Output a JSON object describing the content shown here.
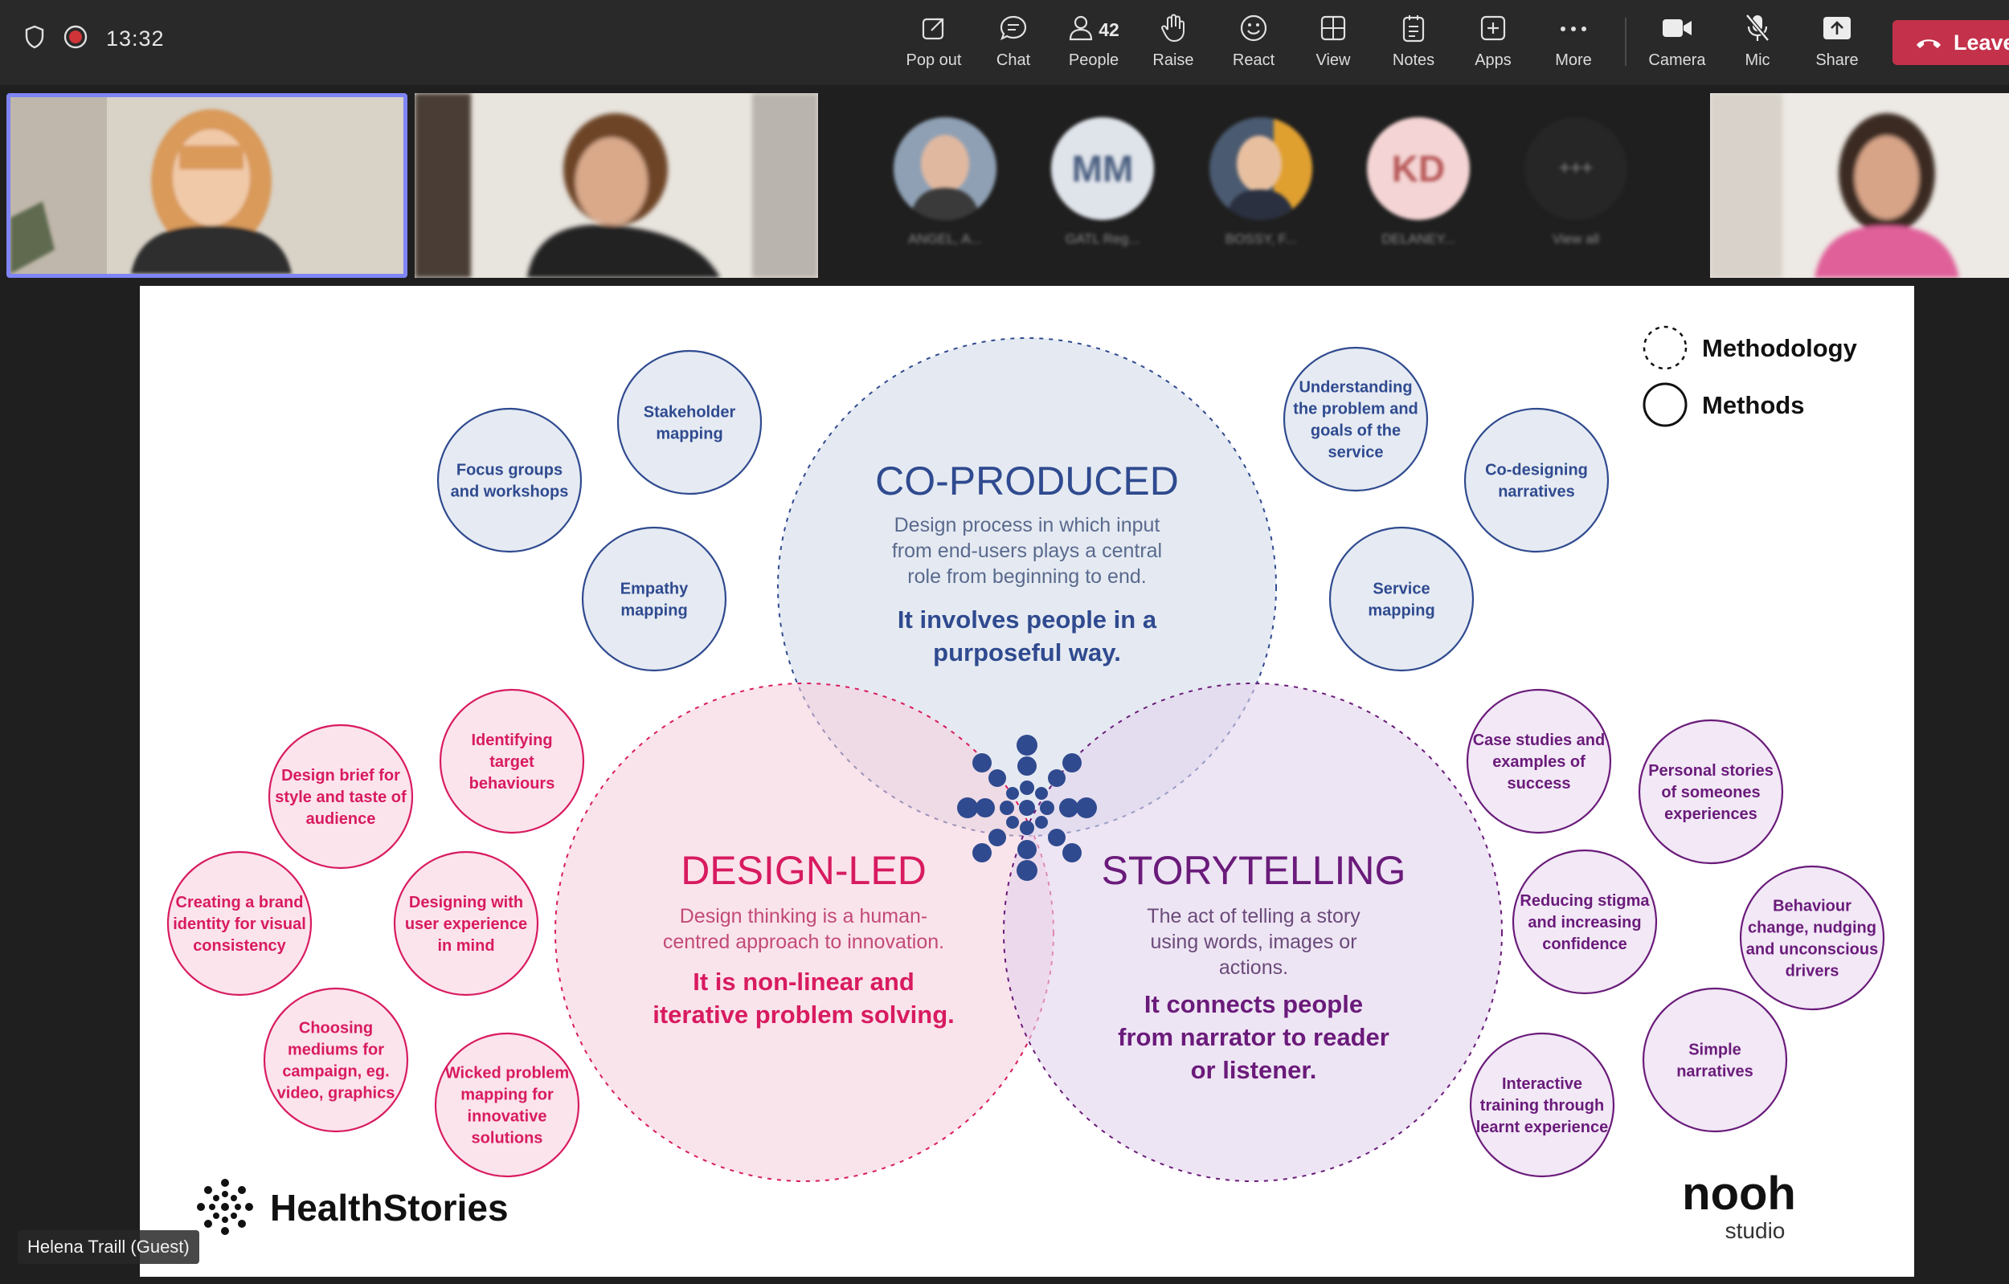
{
  "meeting": {
    "timer": "13:32"
  },
  "toolbar": {
    "popout": "Pop out",
    "chat": "Chat",
    "people": "People",
    "people_count": "42",
    "raise": "Raise",
    "react": "React",
    "view": "View",
    "notes": "Notes",
    "apps": "Apps",
    "more": "More",
    "camera": "Camera",
    "mic": "Mic",
    "share": "Share",
    "leave": "Leave"
  },
  "gallery": {
    "avatars": [
      {
        "initials": "",
        "name": "ANGEL, A..."
      },
      {
        "initials": "MM",
        "name": "GATL Reg..."
      },
      {
        "initials": "",
        "name": "BOSSY, F..."
      },
      {
        "initials": "KD",
        "name": "DELANEY..."
      },
      {
        "initials": "+++",
        "name": "View all"
      }
    ]
  },
  "participant_label": "Helena Traill (Guest)",
  "slide": {
    "legend": {
      "methodology": "Methodology",
      "methods": "Methods"
    },
    "co_produced": {
      "title": "CO-PRODUCED",
      "desc": [
        "Design process in which input",
        "from end-users plays a central",
        "role from beginning to end."
      ],
      "bold": [
        "It involves people in a",
        "purposeful way."
      ],
      "methods": [
        [
          "Stakeholder",
          "mapping"
        ],
        [
          "Focus groups",
          "and workshops"
        ],
        [
          "Empathy",
          "mapping"
        ],
        [
          "Understanding",
          "the problem and",
          "goals of the",
          "service"
        ],
        [
          "Co-designing",
          "narratives"
        ],
        [
          "Service",
          "mapping"
        ]
      ]
    },
    "design_led": {
      "title": "DESIGN-LED",
      "desc": [
        "Design thinking is a human-",
        "centred approach to innovation."
      ],
      "bold": [
        "It is non-linear and",
        "iterative problem solving."
      ],
      "methods": [
        [
          "Identifying",
          "target",
          "behaviours"
        ],
        [
          "Design brief for",
          "style and taste of",
          "audience"
        ],
        [
          "Creating a brand",
          "identity for visual",
          "consistency"
        ],
        [
          "Designing with",
          "user experience",
          "in mind"
        ],
        [
          "Choosing",
          "mediums for",
          "campaign, eg.",
          "video, graphics"
        ],
        [
          "Wicked problem",
          "mapping for",
          "innovative",
          "solutions"
        ]
      ]
    },
    "storytelling": {
      "title": "STORYTELLING",
      "desc": [
        "The act of telling a story",
        "using words, images or",
        "actions."
      ],
      "bold": [
        "It connects people",
        "from narrator to reader",
        "or listener."
      ],
      "methods": [
        [
          "Case studies and",
          "examples of",
          "success"
        ],
        [
          "Personal stories",
          "of someones",
          "experiences"
        ],
        [
          "Reducing stigma",
          "and increasing",
          "confidence"
        ],
        [
          "Behaviour",
          "change, nudging",
          "and unconscious",
          "drivers"
        ],
        [
          "Simple",
          "narratives"
        ],
        [
          "Interactive",
          "training through",
          "learnt experience"
        ]
      ]
    },
    "logo_left": "HealthStories",
    "logo_right": "nooh",
    "logo_right_sub": "studio",
    "colors": {
      "blue": "#2f4a8f",
      "pink": "#d81b60",
      "purple": "#6a1b7a"
    }
  }
}
